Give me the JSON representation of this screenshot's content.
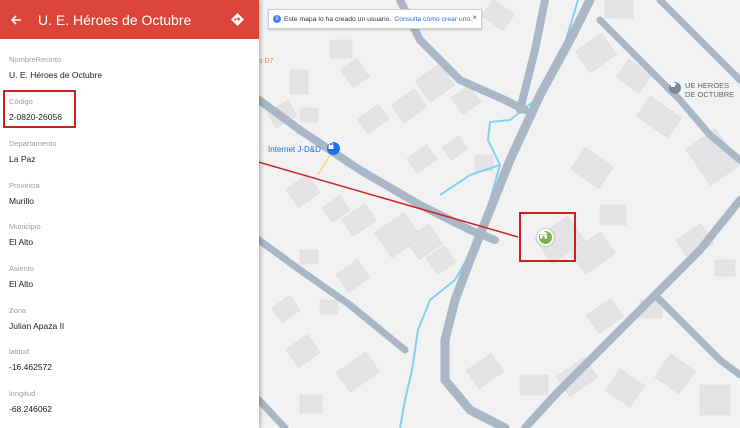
{
  "panel": {
    "title": "U. E. Héroes de Octubre",
    "fields": [
      {
        "label": "NombreRecinto",
        "value": "U. E. Héroes de Octubre"
      },
      {
        "label": "Código",
        "value": "2-0820-26056"
      },
      {
        "label": "Departamento",
        "value": "La Paz"
      },
      {
        "label": "Provincia",
        "value": "Murillo"
      },
      {
        "label": "Municipio",
        "value": "El Alto"
      },
      {
        "label": "Asiento",
        "value": "El Alto"
      },
      {
        "label": "Zona",
        "value": "Julian Apaza II"
      },
      {
        "label": "latitud",
        "value": "-16.462572"
      },
      {
        "label": "longitud",
        "value": "-68.246062"
      }
    ],
    "header_color": "#db4437"
  },
  "notice": {
    "text": "Este mapa lo ha creado un usuario.",
    "link": "Consulta cómo crear uno.",
    "close": "×"
  },
  "map": {
    "labels": {
      "internet": "Internet J-D&D",
      "school_line1": "UE HEROES",
      "school_line2": "DE OCTUBRE",
      "partial": "s D7"
    },
    "road_color": "#a9b7c6",
    "water_color": "#7ed3f0",
    "building_color": "#e4e4e6",
    "marker_color": "#7cb342",
    "annotation_color": "#cc1f1f"
  },
  "icons": {
    "back": "arrow-left-icon",
    "directions": "directions-icon",
    "info": "info-icon",
    "school": "school-icon",
    "internet": "internet-place-icon"
  }
}
